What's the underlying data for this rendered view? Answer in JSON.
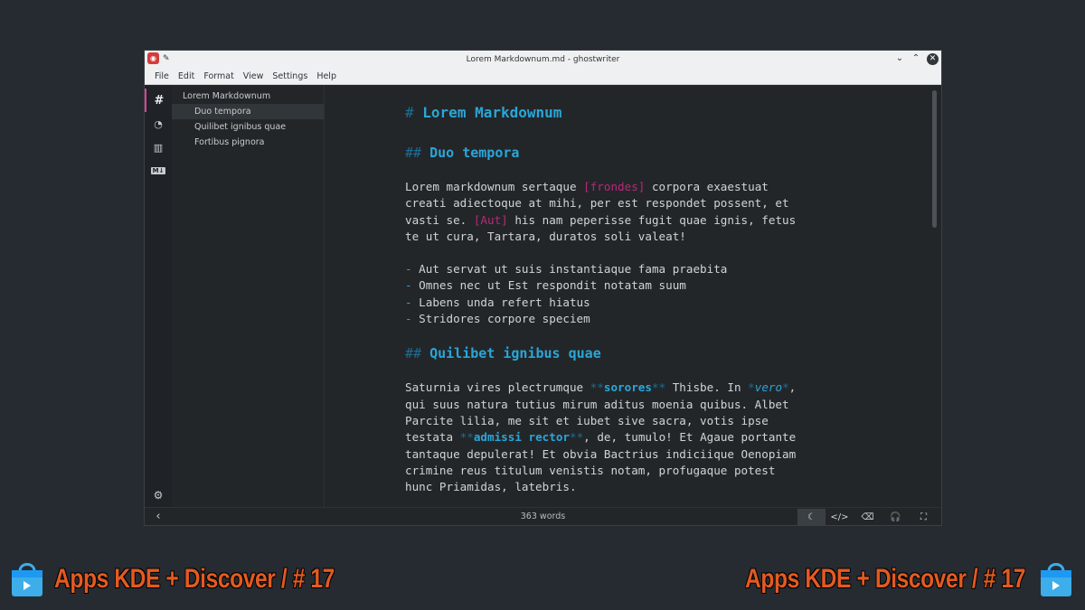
{
  "window": {
    "title": "Lorem Markdownum.md - ghostwriter",
    "pin_icon": "pin-icon",
    "minimize_glyph": "⌄",
    "maximize_glyph": "⌃",
    "close_glyph": "✕"
  },
  "menu": [
    "File",
    "Edit",
    "Format",
    "View",
    "Settings",
    "Help"
  ],
  "sidebar": {
    "tabs": [
      {
        "name": "outline-tab",
        "glyph": "#"
      },
      {
        "name": "statistics-tab",
        "glyph": "◔"
      },
      {
        "name": "document-stats-tab",
        "glyph": "▥"
      },
      {
        "name": "cheat-sheet-tab",
        "glyph": "M↓"
      }
    ],
    "settings_glyph": "⚙"
  },
  "outline": [
    {
      "label": "Lorem Markdownum",
      "level": 1,
      "selected": false
    },
    {
      "label": "Duo tempora",
      "level": 2,
      "selected": true
    },
    {
      "label": "Quilibet ignibus quae",
      "level": 2,
      "selected": false
    },
    {
      "label": "Fortibus pignora",
      "level": 2,
      "selected": false
    }
  ],
  "editor": {
    "h1_mark": "#",
    "h1": "Lorem Markdownum",
    "h2_mark": "##",
    "h2a": "Duo tempora",
    "p1": [
      [
        "Lorem markdownum sertaque ",
        [
          "pink",
          "[frondes]"
        ],
        " corpora exaestuat"
      ],
      [
        "creati adiectoque at mihi, per est respondet possent, et"
      ],
      [
        "vasti se. ",
        [
          "pink",
          "[Aut]"
        ],
        " his nam peperisse fugit quae ignis, fetus"
      ],
      [
        "te ut cura, Tartara, duratos soli valeat!"
      ]
    ],
    "list_mark": "-",
    "list": [
      "Aut servat ut suis instantiaque fama praebita",
      "Omnes nec ut Est respondit notatam suum",
      "Labens unda refert hiatus",
      "Stridores corpore speciem"
    ],
    "h2b": "Quilibet ignibus quae",
    "p2": [
      [
        "Saturnia vires plectrumque ",
        [
          "bm",
          "**"
        ],
        [
          "bold",
          "sorores"
        ],
        [
          "bm",
          "**"
        ],
        " Thisbe. In ",
        [
          "bm",
          "*"
        ],
        [
          "ital",
          "vero"
        ],
        [
          "bm",
          "*"
        ],
        ","
      ],
      [
        "qui suus natura tutius mirum aditus moenia quibus. Albet"
      ],
      [
        "Parcite lilia, me sit et iubet sive sacra, votis ipse"
      ],
      [
        "testata ",
        [
          "bm",
          "**"
        ],
        [
          "bold",
          "admissi rector"
        ],
        [
          "bm",
          "**"
        ],
        ", de, tumulo! Et Agaue portante"
      ],
      [
        "tantaque depulerat! Et obvia Bactrius indiciique Oenopiam"
      ],
      [
        "crimine reus titulum venistis notam, profugaque potest"
      ],
      [
        "hunc Priamidas, latebris."
      ]
    ]
  },
  "status": {
    "word_count": "363 words",
    "back_glyph": "‹",
    "buttons": [
      {
        "name": "dark-mode-icon",
        "glyph": "☾",
        "on": true
      },
      {
        "name": "html-preview-icon",
        "glyph": "</>",
        "on": false
      },
      {
        "name": "hemingway-icon",
        "glyph": "⌫",
        "on": false
      },
      {
        "name": "distraction-free-icon",
        "glyph": "🎧",
        "on": false
      },
      {
        "name": "fullscreen-icon",
        "glyph": "⛶",
        "on": false
      }
    ]
  },
  "banner": {
    "text": "Apps KDE + Discover / # 17"
  },
  "colors": {
    "heading": "#2aa6d8",
    "link": "#b8287a",
    "banner": "#e35a21"
  }
}
